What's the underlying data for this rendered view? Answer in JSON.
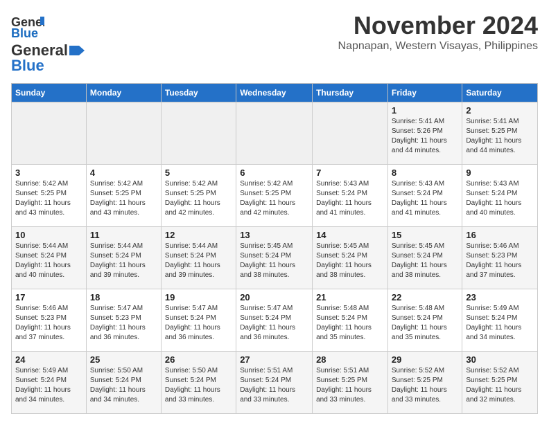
{
  "logo": {
    "line1": "General",
    "line2": "Blue"
  },
  "title": "November 2024",
  "location": "Napnapan, Western Visayas, Philippines",
  "headers": [
    "Sunday",
    "Monday",
    "Tuesday",
    "Wednesday",
    "Thursday",
    "Friday",
    "Saturday"
  ],
  "weeks": [
    [
      {
        "day": "",
        "info": ""
      },
      {
        "day": "",
        "info": ""
      },
      {
        "day": "",
        "info": ""
      },
      {
        "day": "",
        "info": ""
      },
      {
        "day": "",
        "info": ""
      },
      {
        "day": "1",
        "info": "Sunrise: 5:41 AM\nSunset: 5:26 PM\nDaylight: 11 hours and 44 minutes."
      },
      {
        "day": "2",
        "info": "Sunrise: 5:41 AM\nSunset: 5:25 PM\nDaylight: 11 hours and 44 minutes."
      }
    ],
    [
      {
        "day": "3",
        "info": "Sunrise: 5:42 AM\nSunset: 5:25 PM\nDaylight: 11 hours and 43 minutes."
      },
      {
        "day": "4",
        "info": "Sunrise: 5:42 AM\nSunset: 5:25 PM\nDaylight: 11 hours and 43 minutes."
      },
      {
        "day": "5",
        "info": "Sunrise: 5:42 AM\nSunset: 5:25 PM\nDaylight: 11 hours and 42 minutes."
      },
      {
        "day": "6",
        "info": "Sunrise: 5:42 AM\nSunset: 5:25 PM\nDaylight: 11 hours and 42 minutes."
      },
      {
        "day": "7",
        "info": "Sunrise: 5:43 AM\nSunset: 5:24 PM\nDaylight: 11 hours and 41 minutes."
      },
      {
        "day": "8",
        "info": "Sunrise: 5:43 AM\nSunset: 5:24 PM\nDaylight: 11 hours and 41 minutes."
      },
      {
        "day": "9",
        "info": "Sunrise: 5:43 AM\nSunset: 5:24 PM\nDaylight: 11 hours and 40 minutes."
      }
    ],
    [
      {
        "day": "10",
        "info": "Sunrise: 5:44 AM\nSunset: 5:24 PM\nDaylight: 11 hours and 40 minutes."
      },
      {
        "day": "11",
        "info": "Sunrise: 5:44 AM\nSunset: 5:24 PM\nDaylight: 11 hours and 39 minutes."
      },
      {
        "day": "12",
        "info": "Sunrise: 5:44 AM\nSunset: 5:24 PM\nDaylight: 11 hours and 39 minutes."
      },
      {
        "day": "13",
        "info": "Sunrise: 5:45 AM\nSunset: 5:24 PM\nDaylight: 11 hours and 38 minutes."
      },
      {
        "day": "14",
        "info": "Sunrise: 5:45 AM\nSunset: 5:24 PM\nDaylight: 11 hours and 38 minutes."
      },
      {
        "day": "15",
        "info": "Sunrise: 5:45 AM\nSunset: 5:24 PM\nDaylight: 11 hours and 38 minutes."
      },
      {
        "day": "16",
        "info": "Sunrise: 5:46 AM\nSunset: 5:23 PM\nDaylight: 11 hours and 37 minutes."
      }
    ],
    [
      {
        "day": "17",
        "info": "Sunrise: 5:46 AM\nSunset: 5:23 PM\nDaylight: 11 hours and 37 minutes."
      },
      {
        "day": "18",
        "info": "Sunrise: 5:47 AM\nSunset: 5:23 PM\nDaylight: 11 hours and 36 minutes."
      },
      {
        "day": "19",
        "info": "Sunrise: 5:47 AM\nSunset: 5:24 PM\nDaylight: 11 hours and 36 minutes."
      },
      {
        "day": "20",
        "info": "Sunrise: 5:47 AM\nSunset: 5:24 PM\nDaylight: 11 hours and 36 minutes."
      },
      {
        "day": "21",
        "info": "Sunrise: 5:48 AM\nSunset: 5:24 PM\nDaylight: 11 hours and 35 minutes."
      },
      {
        "day": "22",
        "info": "Sunrise: 5:48 AM\nSunset: 5:24 PM\nDaylight: 11 hours and 35 minutes."
      },
      {
        "day": "23",
        "info": "Sunrise: 5:49 AM\nSunset: 5:24 PM\nDaylight: 11 hours and 34 minutes."
      }
    ],
    [
      {
        "day": "24",
        "info": "Sunrise: 5:49 AM\nSunset: 5:24 PM\nDaylight: 11 hours and 34 minutes."
      },
      {
        "day": "25",
        "info": "Sunrise: 5:50 AM\nSunset: 5:24 PM\nDaylight: 11 hours and 34 minutes."
      },
      {
        "day": "26",
        "info": "Sunrise: 5:50 AM\nSunset: 5:24 PM\nDaylight: 11 hours and 33 minutes."
      },
      {
        "day": "27",
        "info": "Sunrise: 5:51 AM\nSunset: 5:24 PM\nDaylight: 11 hours and 33 minutes."
      },
      {
        "day": "28",
        "info": "Sunrise: 5:51 AM\nSunset: 5:25 PM\nDaylight: 11 hours and 33 minutes."
      },
      {
        "day": "29",
        "info": "Sunrise: 5:52 AM\nSunset: 5:25 PM\nDaylight: 11 hours and 33 minutes."
      },
      {
        "day": "30",
        "info": "Sunrise: 5:52 AM\nSunset: 5:25 PM\nDaylight: 11 hours and 32 minutes."
      }
    ]
  ]
}
